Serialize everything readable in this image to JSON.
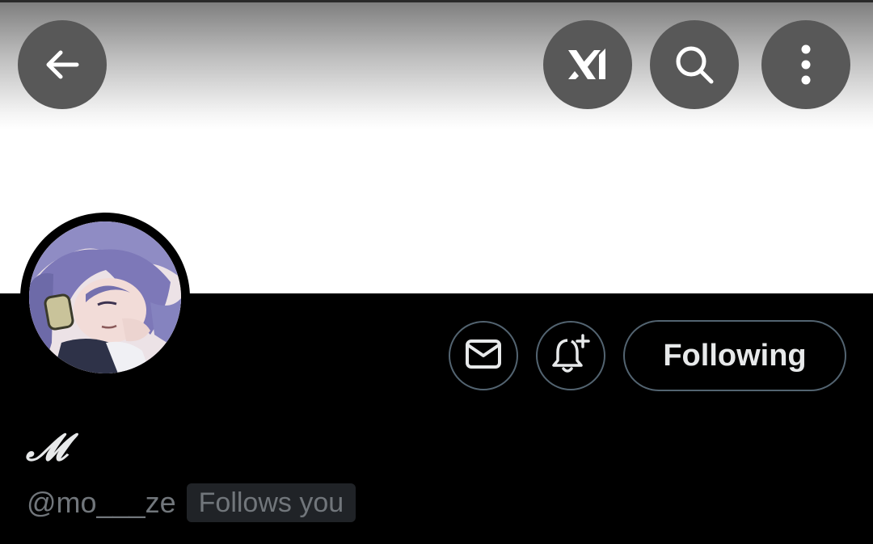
{
  "header": {
    "back_icon": "arrow-left-icon",
    "grok_icon": "grok-icon",
    "search_icon": "search-icon",
    "more_icon": "more-vertical-icon"
  },
  "profile": {
    "display_name": "𝓜",
    "handle": "@mo___ze",
    "follows_you_label": "Follows you"
  },
  "actions": {
    "message_icon": "envelope-icon",
    "notification_icon": "bell-plus-icon",
    "following_label": "Following"
  },
  "colors": {
    "background": "#000000",
    "banner": "#ffffff",
    "button_overlay": "#585858",
    "outline": "#536471",
    "primary_text": "#e7e9ea",
    "secondary_text": "#71767b",
    "badge_bg": "#202327"
  }
}
